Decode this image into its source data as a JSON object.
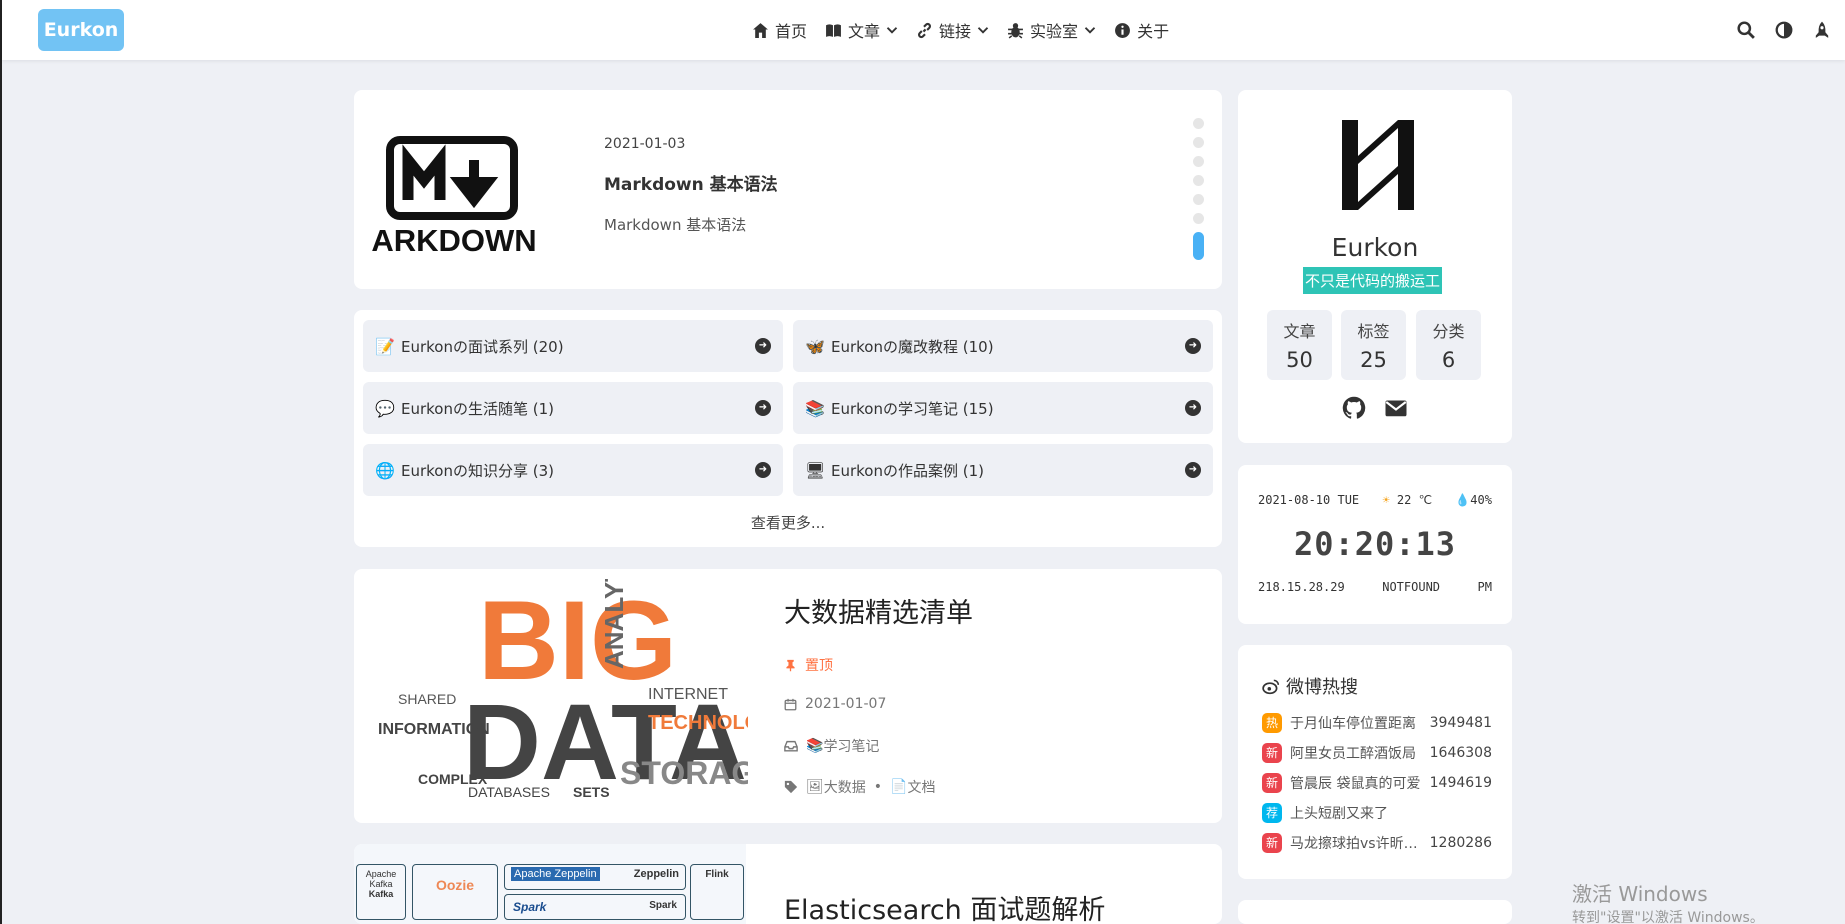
{
  "nav": {
    "logo": "Eurkon",
    "items": [
      {
        "label": "首页",
        "icon": "home-icon"
      },
      {
        "label": "文章",
        "icon": "book-icon"
      },
      {
        "label": "链接",
        "icon": "link-icon"
      },
      {
        "label": "实验室",
        "icon": "bug-icon"
      },
      {
        "label": "关于",
        "icon": "info-icon"
      }
    ],
    "right_icons": [
      "search-icon",
      "theme-toggle-icon",
      "rocket-icon"
    ]
  },
  "hero": {
    "logo_text": "ARKDOWN",
    "date": "2021-01-03",
    "title": "Markdown 基本语法",
    "desc": "Markdown 基本语法"
  },
  "categories": {
    "items": [
      {
        "icon": "📝",
        "label": "Eurkonの面试系列 (20)"
      },
      {
        "icon": "🦋",
        "label": "Eurkonの魔改教程 (10)"
      },
      {
        "icon": "💬",
        "label": "Eurkonの生活随笔 (1)"
      },
      {
        "icon": "📚",
        "label": "Eurkonの学习笔记 (15)"
      },
      {
        "icon": "🌐",
        "label": "Eurkonの知识分享 (3)"
      },
      {
        "icon": "🖥",
        "label": "Eurkonの作品案例 (1)"
      }
    ],
    "more": "查看更多..."
  },
  "post1": {
    "title": "大数据精选清单",
    "sticky": "置顶",
    "date": "2021-01-07",
    "category": "学习笔记",
    "tags": [
      "大数据",
      "文档"
    ],
    "tag_sep": "•"
  },
  "post2": {
    "title": "Elasticsearch 面试题解析",
    "thumb_labels": [
      "Apache Kafka",
      "Kafka",
      "Oozie",
      "Apache Zeppelin",
      "Zeppelin",
      "Flink",
      "Spark",
      "Spark"
    ]
  },
  "profile": {
    "name": "Eurkon",
    "motto": "不只是代码的搬运工",
    "stats": [
      {
        "label": "文章",
        "value": "50"
      },
      {
        "label": "标签",
        "value": "25"
      },
      {
        "label": "分类",
        "value": "6"
      }
    ]
  },
  "clock": {
    "date": "2021-08-10 TUE",
    "temp": "22 ℃",
    "humidity": "40%",
    "time": "20:20:13",
    "ip": "218.15.28.29",
    "location": "NOTFOUND",
    "ampm": "PM"
  },
  "weibo": {
    "title": "微博热搜",
    "items": [
      {
        "badge": "热",
        "color": "#ff9a00",
        "text": "于月仙车停位置距离",
        "num": "3949481"
      },
      {
        "badge": "新",
        "color": "#ea444d",
        "text": "阿里女员工醉酒饭局",
        "num": "1646308"
      },
      {
        "badge": "新",
        "color": "#ea444d",
        "text": "管晨辰 袋鼠真的可爱",
        "num": "1494619"
      },
      {
        "badge": "荐",
        "color": "#00b7ee",
        "text": "上头短剧又来了",
        "num": ""
      },
      {
        "badge": "新",
        "color": "#ea444d",
        "text": "马龙擦球拍vs许昕擦球拍",
        "num": "1280286"
      }
    ]
  },
  "watermark": {
    "line1": "激活 Windows",
    "line2": "转到\"设置\"以激活 Windows。"
  },
  "colors": {
    "accent": "#49b1f5",
    "logo_bg": "#72c3f4",
    "motto_bg": "#2ec4b6",
    "sticky": "#ff7242"
  }
}
